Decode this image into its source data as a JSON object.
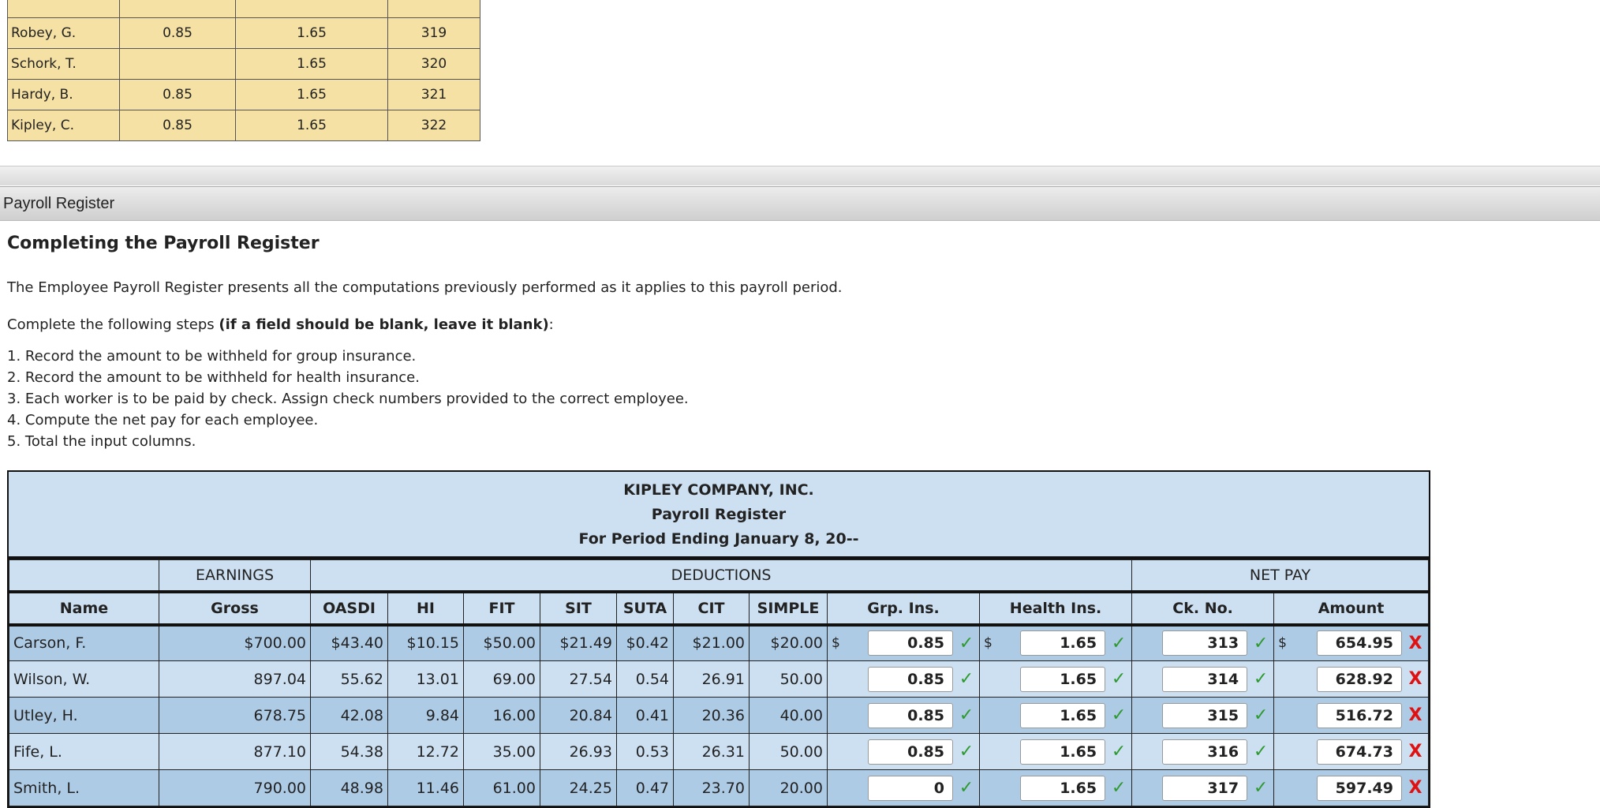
{
  "top_table": {
    "rows": [
      {
        "name": "Robey, G.",
        "grp": "0.85",
        "health": "1.65",
        "ck": "319"
      },
      {
        "name": "Schork, T.",
        "grp": "",
        "health": "1.65",
        "ck": "320"
      },
      {
        "name": "Hardy, B.",
        "grp": "0.85",
        "health": "1.65",
        "ck": "321"
      },
      {
        "name": "Kipley, C.",
        "grp": "0.85",
        "health": "1.65",
        "ck": "322"
      }
    ]
  },
  "section": {
    "title": "Payroll Register"
  },
  "content": {
    "heading": "Completing the Payroll Register",
    "intro": "The Employee Payroll Register presents all the computations previously performed as it applies to this payroll period.",
    "steps_prefix": "Complete the following steps ",
    "steps_bold": "(if a field should be blank, leave it blank)",
    "steps_suffix": ":",
    "steps": [
      "1. Record the amount to be withheld for group insurance.",
      "2. Record the amount to be withheld for health insurance.",
      "3. Each worker is to be paid by check. Assign check numbers provided to the correct employee.",
      "4. Compute the net pay for each employee.",
      "5. Total the input columns."
    ]
  },
  "register": {
    "company": "KIPLEY COMPANY, INC.",
    "title": "Payroll Register",
    "period": "For Period Ending January 8, 20--",
    "groups": {
      "earnings": "EARNINGS",
      "deductions": "DEDUCTIONS",
      "net_pay": "NET PAY"
    },
    "columns": [
      "Name",
      "Gross",
      "OASDI",
      "HI",
      "FIT",
      "SIT",
      "SUTA",
      "CIT",
      "SIMPLE",
      "Grp. Ins.",
      "Health Ins.",
      "Ck. No.",
      "Amount"
    ],
    "currency_symbol": "$",
    "rows": [
      {
        "name": "Carson, F.",
        "gross": "$700.00",
        "oasdi": "$43.40",
        "hi": "$10.15",
        "fit": "$50.00",
        "sit": "$21.49",
        "suta": "$0.42",
        "cit": "$21.00",
        "simple": "$20.00",
        "grp": "0.85",
        "health": "1.65",
        "ck": "313",
        "amount": "654.95"
      },
      {
        "name": "Wilson, W.",
        "gross": "897.04",
        "oasdi": "55.62",
        "hi": "13.01",
        "fit": "69.00",
        "sit": "27.54",
        "suta": "0.54",
        "cit": "26.91",
        "simple": "50.00",
        "grp": "0.85",
        "health": "1.65",
        "ck": "314",
        "amount": "628.92"
      },
      {
        "name": "Utley, H.",
        "gross": "678.75",
        "oasdi": "42.08",
        "hi": "9.84",
        "fit": "16.00",
        "sit": "20.84",
        "suta": "0.41",
        "cit": "20.36",
        "simple": "40.00",
        "grp": "0.85",
        "health": "1.65",
        "ck": "315",
        "amount": "516.72"
      },
      {
        "name": "Fife, L.",
        "gross": "877.10",
        "oasdi": "54.38",
        "hi": "12.72",
        "fit": "35.00",
        "sit": "26.93",
        "suta": "0.53",
        "cit": "26.31",
        "simple": "50.00",
        "grp": "0.85",
        "health": "1.65",
        "ck": "316",
        "amount": "674.73"
      },
      {
        "name": "Smith, L.",
        "gross": "790.00",
        "oasdi": "48.98",
        "hi": "11.46",
        "fit": "61.00",
        "sit": "24.25",
        "suta": "0.47",
        "cit": "23.70",
        "simple": "20.00",
        "grp": "0",
        "health": "1.65",
        "ck": "317",
        "amount": "597.49"
      }
    ],
    "marks": {
      "correct": "✓",
      "incorrect": "X"
    }
  },
  "colors": {
    "register_bg": "#cde0f2",
    "register_row_alt": "#aecbe6",
    "top_table_bg": "#f5e1a4",
    "correct": "#2e9a2e",
    "incorrect": "#e01010"
  }
}
